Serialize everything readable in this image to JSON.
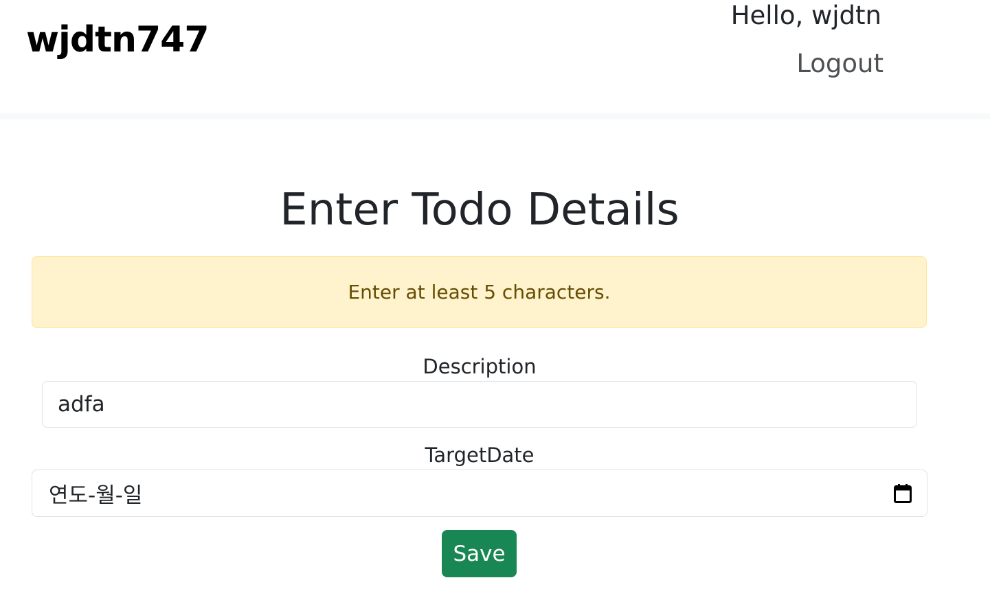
{
  "header": {
    "brand": "wjdtn747",
    "greeting": "Hello, wjdtn",
    "logout_label": "Logout"
  },
  "main": {
    "title": "Enter Todo Details",
    "alert_message": "Enter at least 5 characters.",
    "description_label": "Description",
    "description_value": "adfa",
    "target_date_label": "TargetDate",
    "target_date_placeholder": "연도-월-일",
    "save_label": "Save"
  },
  "colors": {
    "save_button": "#198754",
    "alert_background": "#fff3cd",
    "alert_text": "#664d03"
  },
  "icons": {
    "date_picker": "calendar-icon"
  }
}
